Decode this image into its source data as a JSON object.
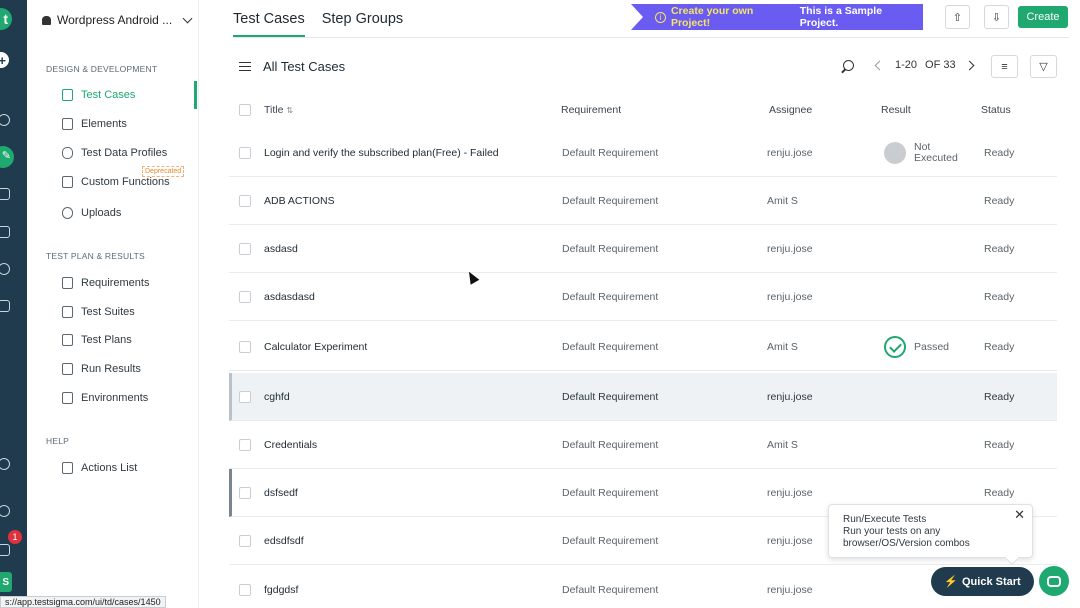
{
  "app": {
    "project_name": "Wordpress Android ..."
  },
  "sidebar": {
    "sections": [
      {
        "title": "DESIGN & DEVELOPMENT"
      },
      {
        "title": "TEST PLAN & RESULTS"
      },
      {
        "title": "HELP"
      }
    ],
    "items": [
      {
        "label": "Test Cases"
      },
      {
        "label": "Elements"
      },
      {
        "label": "Test Data Profiles"
      },
      {
        "label": "Custom Functions"
      },
      {
        "label": "Uploads"
      },
      {
        "label": "Requirements"
      },
      {
        "label": "Test Suites"
      },
      {
        "label": "Test Plans"
      },
      {
        "label": "Run Results"
      },
      {
        "label": "Environments"
      },
      {
        "label": "Actions List"
      }
    ],
    "deprecated_label": "Deprecated"
  },
  "rail": {
    "notification_count": "1",
    "avatar_letter": "S"
  },
  "header": {
    "tabs": [
      {
        "label": "Test Cases"
      },
      {
        "label": "Step Groups"
      }
    ],
    "banner": {
      "highlight": "Create your own Project!",
      "text": "This is a Sample Project."
    },
    "create_label": "Create"
  },
  "toolbar": {
    "list_title": "All Test Cases",
    "pagination": {
      "range": "1-20",
      "of_label": "OF 33"
    }
  },
  "table": {
    "columns": {
      "title": "Title",
      "requirement": "Requirement",
      "assignee": "Assignee",
      "result": "Result",
      "status": "Status"
    },
    "rows": [
      {
        "title": "Login and verify the subscribed plan(Free) - Failed",
        "requirement": "Default Requirement",
        "assignee": "renju.jose",
        "result_l1": "Not",
        "result_l2": "Executed",
        "status": "Ready"
      },
      {
        "title": "ADB ACTIONS",
        "requirement": "Default Requirement",
        "assignee": "Amit S",
        "result": "",
        "status": "Ready"
      },
      {
        "title": "asdasd",
        "requirement": "Default Requirement",
        "assignee": "renju.jose",
        "result": "",
        "status": "Ready"
      },
      {
        "title": "asdasdasd",
        "requirement": "Default Requirement",
        "assignee": "renju.jose",
        "result": "",
        "status": "Ready"
      },
      {
        "title": "Calculator Experiment",
        "requirement": "Default Requirement",
        "assignee": "Amit S",
        "result": "Passed",
        "status": "Ready"
      },
      {
        "title": "cghfd",
        "requirement": "Default Requirement",
        "assignee": "renju.jose",
        "result": "",
        "status": "Ready"
      },
      {
        "title": "Credentials",
        "requirement": "Default Requirement",
        "assignee": "Amit S",
        "result": "",
        "status": "Ready"
      },
      {
        "title": "dsfsedf",
        "requirement": "Default Requirement",
        "assignee": "renju.jose",
        "result": "",
        "status": "Ready"
      },
      {
        "title": "edsdfsdf",
        "requirement": "Default Requirement",
        "assignee": "renju.jose",
        "result": "",
        "status": ""
      },
      {
        "title": "fgdgdsf",
        "requirement": "Default Requirement",
        "assignee": "renju.jose",
        "result": "",
        "status": ""
      }
    ]
  },
  "popover": {
    "title": "Run/Execute Tests",
    "line1": "Run your tests on any",
    "line2": "browser/OS/Version combos"
  },
  "quick_start_label": "Quick Start",
  "status_url": "s://app.testsigma.com/ui/td/cases/1450",
  "colors": {
    "accent": "#1fa870",
    "rail": "#1f3b4d",
    "banner": "#6a5cf0",
    "banner_highlight": "#f5e663"
  }
}
